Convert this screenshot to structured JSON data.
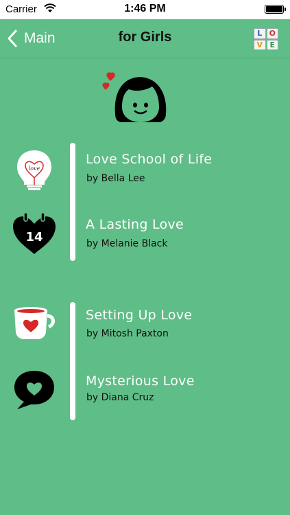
{
  "status_bar": {
    "carrier": "Carrier",
    "time": "1:46 PM"
  },
  "navbar": {
    "back_label": "Main",
    "title": "for Girls",
    "logo_letters": [
      "L",
      "O",
      "V",
      "E"
    ]
  },
  "books": [
    {
      "title": "Love School of Life",
      "author": "by Bella Lee",
      "icon": "lightbulb-heart-icon"
    },
    {
      "title": "A Lasting Love",
      "author": "by Melanie Black",
      "icon": "heart-calendar-icon",
      "icon_text": "14"
    },
    {
      "title": "Setting Up Love",
      "author": "by Mitosh Paxton",
      "icon": "tea-cup-heart-icon"
    },
    {
      "title": "Mysterious Love",
      "author": "by Diana Cruz",
      "icon": "speech-bubble-heart-icon"
    }
  ],
  "colors": {
    "background": "#5fbd87",
    "heart_red": "#d62828",
    "text_white": "#ffffff",
    "text_dark": "#111111"
  }
}
